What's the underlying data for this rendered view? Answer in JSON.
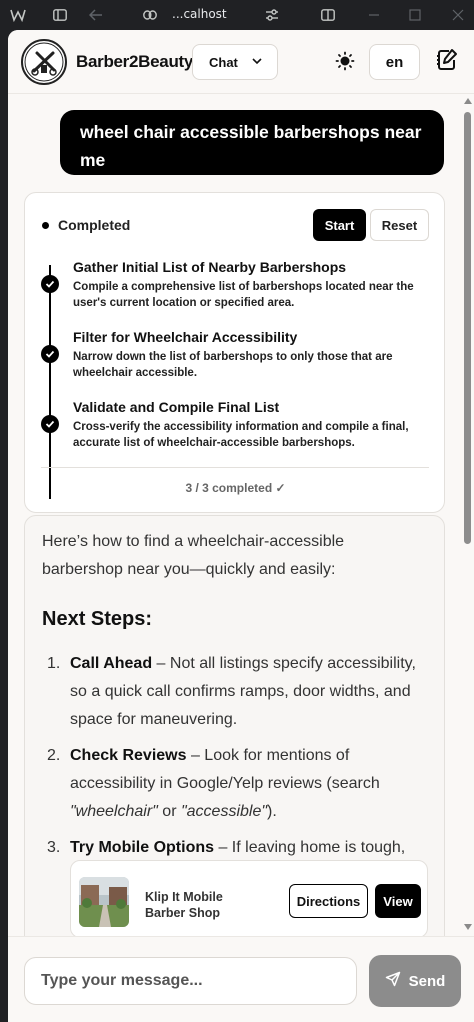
{
  "browser": {
    "url": "...calhost"
  },
  "header": {
    "logo_text": "BARBER 2 BEAUTY",
    "brand": "Barber2Beauty",
    "mode_label": "Chat",
    "lang_label": "en"
  },
  "user_message": "wheel chair accessible barbershops near me",
  "plan": {
    "status": "Completed",
    "start_label": "Start",
    "reset_label": "Reset",
    "steps": [
      {
        "title": "Gather Initial List of Nearby Barbershops",
        "desc": "Compile a comprehensive list of barbershops located near the user's current location or specified area."
      },
      {
        "title": "Filter for Wheelchair Accessibility",
        "desc": "Narrow down the list of barbershops to only those that are wheelchair accessible."
      },
      {
        "title": "Validate and Compile Final List",
        "desc": "Cross-verify the accessibility information and compile a final, accurate list of wheelchair-accessible barbershops."
      }
    ],
    "progress": "3 / 3 completed ✓"
  },
  "reply": {
    "intro": "Here’s how to find a wheelchair-accessible barbershop near you—quickly and easily:",
    "heading": "Next Steps:",
    "items": [
      {
        "num": "1.",
        "title": "Call Ahead",
        "text": " – Not all listings specify accessibility, so a quick call confirms ramps, door widths, and space for maneuvering."
      },
      {
        "num": "2.",
        "title": "Check Reviews",
        "text_a": " – Look for mentions of accessibility in Google/Yelp reviews (search ",
        "em_a": "\"wheelchair\"",
        "text_b": " or ",
        "em_b": "\"accessible\"",
        "text_c": ")."
      },
      {
        "num": "3.",
        "title": "Try Mobile Options",
        "text": " – If leaving home is tough,"
      }
    ],
    "shop": {
      "name": "Klip It Mobile Barber Shop",
      "directions_label": "Directions",
      "view_label": "View"
    }
  },
  "composer": {
    "placeholder": "Type your message...",
    "send_label": "Send"
  }
}
